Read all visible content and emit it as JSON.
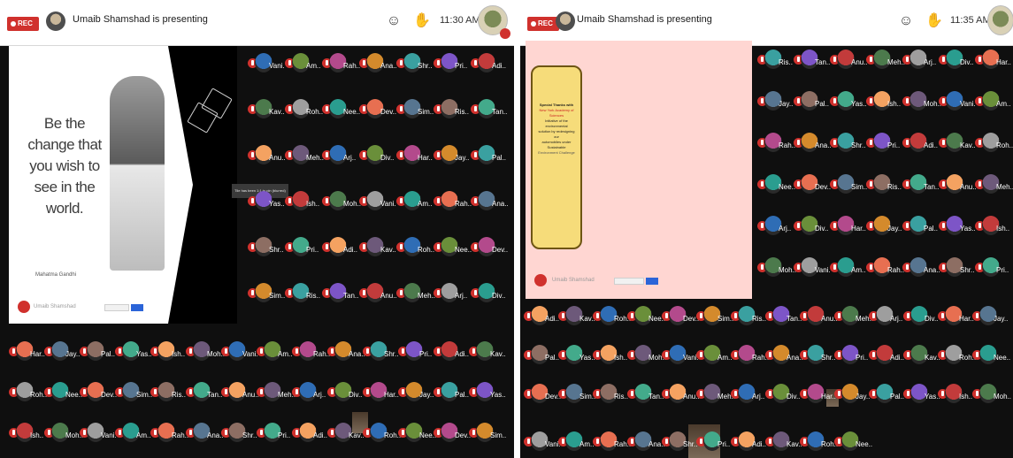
{
  "left": {
    "topbar": {
      "rec_label": "REC",
      "presenter": "Umaib Shamshad is presenting",
      "time": "11:30 AM"
    },
    "shared_slide": {
      "quote": "Be the change that you wish to see in the world.",
      "author": "Mahatma Gandhi",
      "presenter_name": "Umaib Shamshad"
    },
    "tooltip": "Tile has been 1:1 to pin (blurred)"
  },
  "right": {
    "topbar": {
      "rec_label": "REC",
      "presenter": "Umaib Shamshad is presenting",
      "time": "11:35 AM"
    },
    "shared_slide": {
      "note_lines": [
        "Special Thanks with",
        "New York Academy of Sciences",
        "Initiative of the environmental",
        "solution by redesigning our",
        "automobiles under Sustainable",
        "Environment Challenge"
      ],
      "presenter_name": "Umaib Shamshad"
    }
  },
  "participant_names": [
    "Vani.",
    "Am..",
    "Rah..",
    "Ana..",
    "Shr..",
    "Pri..",
    "Adi..",
    "Kav..",
    "Roh..",
    "Nee..",
    "Dev..",
    "Sim..",
    "Ris..",
    "Tan..",
    "Anu..",
    "Meh..",
    "Arj..",
    "Div..",
    "Har..",
    "Jay..",
    "Pal..",
    "Yas..",
    "Ish..",
    "Moh.."
  ],
  "avatar_colors": [
    "#2f6db5",
    "#6a8f3a",
    "#b34a8c",
    "#d48a2c",
    "#3aa0a0",
    "#7d55c7",
    "#c23b3b",
    "#4c7a4c",
    "#9e9e9e",
    "#2a9d8f",
    "#e76f51",
    "#577590",
    "#8d6e63",
    "#43aa8b",
    "#f4a261",
    "#6d597a"
  ],
  "colors": {
    "rec_red": "#d0312d",
    "dark_background": "#0f0f0f",
    "slide_pink": "#ffd6d2",
    "note_yellow": "#f6dc7a"
  }
}
